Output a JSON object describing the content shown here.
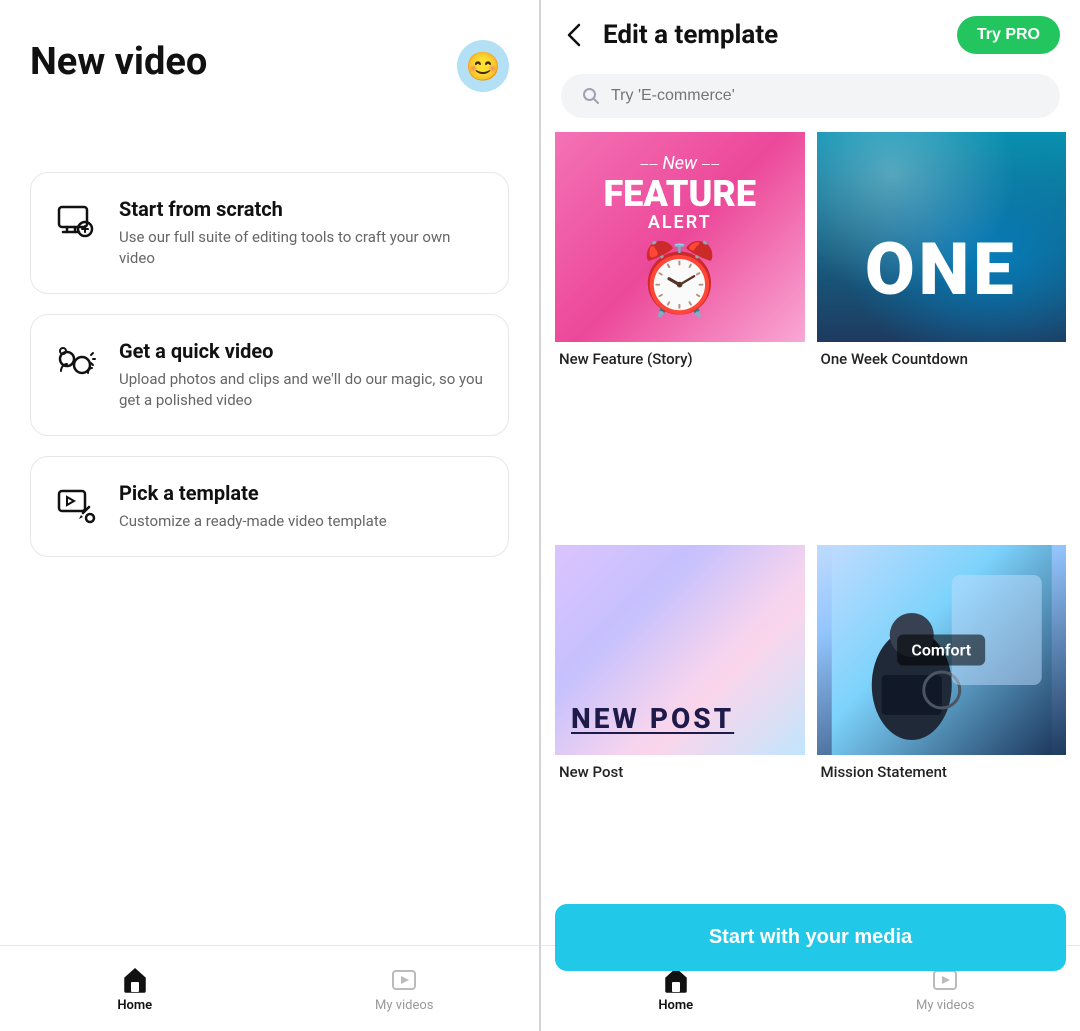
{
  "left": {
    "title": "New video",
    "avatar_emoji": "😊",
    "options": [
      {
        "id": "scratch",
        "title": "Start from scratch",
        "description": "Use our full suite of editing tools to craft your own video",
        "icon": "scratch-icon"
      },
      {
        "id": "quick",
        "title": "Get a quick video",
        "description": "Upload photos and clips and we'll do our magic, so you get a polished video",
        "icon": "quick-icon"
      },
      {
        "id": "template",
        "title": "Pick a template",
        "description": "Customize a ready-made video template",
        "icon": "template-icon"
      }
    ],
    "nav": [
      {
        "id": "home",
        "label": "Home",
        "active": true
      },
      {
        "id": "my-videos",
        "label": "My videos",
        "active": false
      }
    ]
  },
  "right": {
    "back_label": "←",
    "title": "Edit a template",
    "try_pro_label": "Try PRO",
    "search_placeholder": "Try 'E-commerce'",
    "templates": [
      {
        "id": "new-feature",
        "label": "New Feature (Story)",
        "type": "pink"
      },
      {
        "id": "one-week",
        "label": "One Week Countdown",
        "type": "ocean"
      },
      {
        "id": "new-post",
        "label": "New Post",
        "type": "gradient"
      },
      {
        "id": "mission",
        "label": "Mission Statement",
        "type": "dark",
        "badge": "Comfort"
      }
    ],
    "start_media_label": "Start with your media",
    "nav": [
      {
        "id": "home",
        "label": "Home",
        "active": true
      },
      {
        "id": "my-videos",
        "label": "My videos",
        "active": false
      }
    ]
  }
}
